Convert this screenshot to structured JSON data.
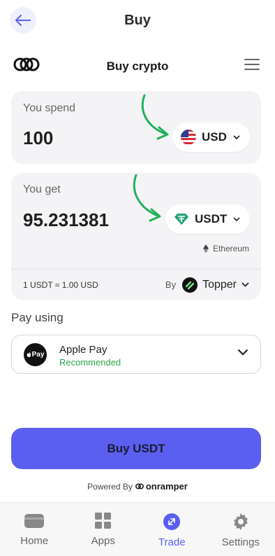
{
  "header": {
    "title": "Buy"
  },
  "widget": {
    "title": "Buy crypto"
  },
  "spend": {
    "label": "You spend",
    "amount": "100",
    "currency": "USD"
  },
  "get": {
    "label": "You get",
    "amount": "95.231381",
    "currency": "USDT",
    "network": "Ethereum"
  },
  "quote": {
    "rate": "1 USDT ≈ 1.00 USD",
    "by_label": "By",
    "provider": "Topper"
  },
  "payment": {
    "section_label": "Pay using",
    "method": "Apple Pay",
    "icon_text": "Pay",
    "tag": "Recommended"
  },
  "cta": {
    "label": "Buy USDT"
  },
  "footer": {
    "powered_by": "Powered By",
    "brand": "onramper"
  },
  "nav": [
    {
      "label": "Home",
      "icon": "home-icon",
      "active": false
    },
    {
      "label": "Apps",
      "icon": "apps-icon",
      "active": false
    },
    {
      "label": "Trade",
      "icon": "trade-icon",
      "active": true
    },
    {
      "label": "Settings",
      "icon": "settings-icon",
      "active": false
    }
  ],
  "colors": {
    "accent": "#5b5ff0",
    "success": "#2aa64a",
    "card_bg": "#f4f4f6",
    "tether": "#26a17b",
    "annotation_arrow": "#22b15a"
  }
}
